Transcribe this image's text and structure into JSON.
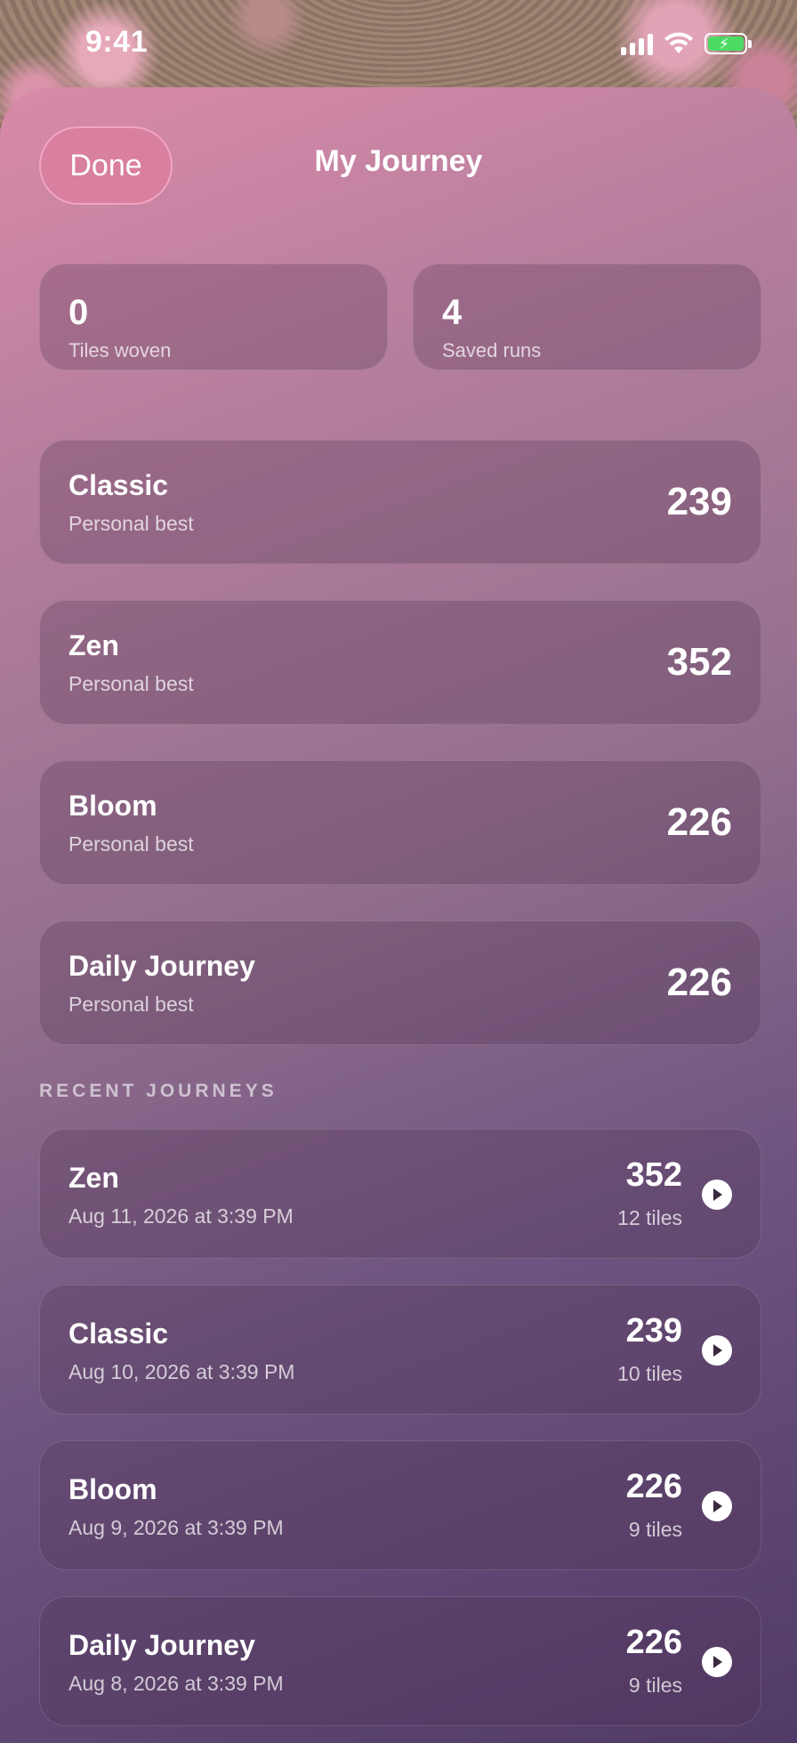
{
  "status_bar": {
    "time": "9:41"
  },
  "header": {
    "done_label": "Done",
    "title": "My Journey"
  },
  "stats": [
    {
      "value": "0",
      "label": "Tiles woven"
    },
    {
      "value": "4",
      "label": "Saved runs"
    }
  ],
  "personal_bests": [
    {
      "mode": "Classic",
      "subtitle": "Personal best",
      "score": "239"
    },
    {
      "mode": "Zen",
      "subtitle": "Personal best",
      "score": "352"
    },
    {
      "mode": "Bloom",
      "subtitle": "Personal best",
      "score": "226"
    },
    {
      "mode": "Daily Journey",
      "subtitle": "Personal best",
      "score": "226"
    }
  ],
  "recent": {
    "section_label": "RECENT JOURNEYS",
    "items": [
      {
        "mode": "Zen",
        "date": "Aug 11, 2026 at 3:39 PM",
        "score": "352",
        "tiles": "12 tiles"
      },
      {
        "mode": "Classic",
        "date": "Aug 10, 2026 at 3:39 PM",
        "score": "239",
        "tiles": "10 tiles"
      },
      {
        "mode": "Bloom",
        "date": "Aug 9, 2026 at 3:39 PM",
        "score": "226",
        "tiles": "9 tiles"
      },
      {
        "mode": "Daily Journey",
        "date": "Aug 8, 2026 at 3:39 PM",
        "score": "226",
        "tiles": "9 tiles"
      }
    ]
  },
  "icons": {
    "play": "play-icon",
    "wifi": "wifi-icon",
    "signal": "cellular-signal-icon",
    "battery": "battery-charging-icon"
  },
  "colors": {
    "done_button": "#d97fa0",
    "battery_fill": "#4cd964",
    "sheet_top": "#d98aa8",
    "sheet_bottom": "#503a68"
  }
}
